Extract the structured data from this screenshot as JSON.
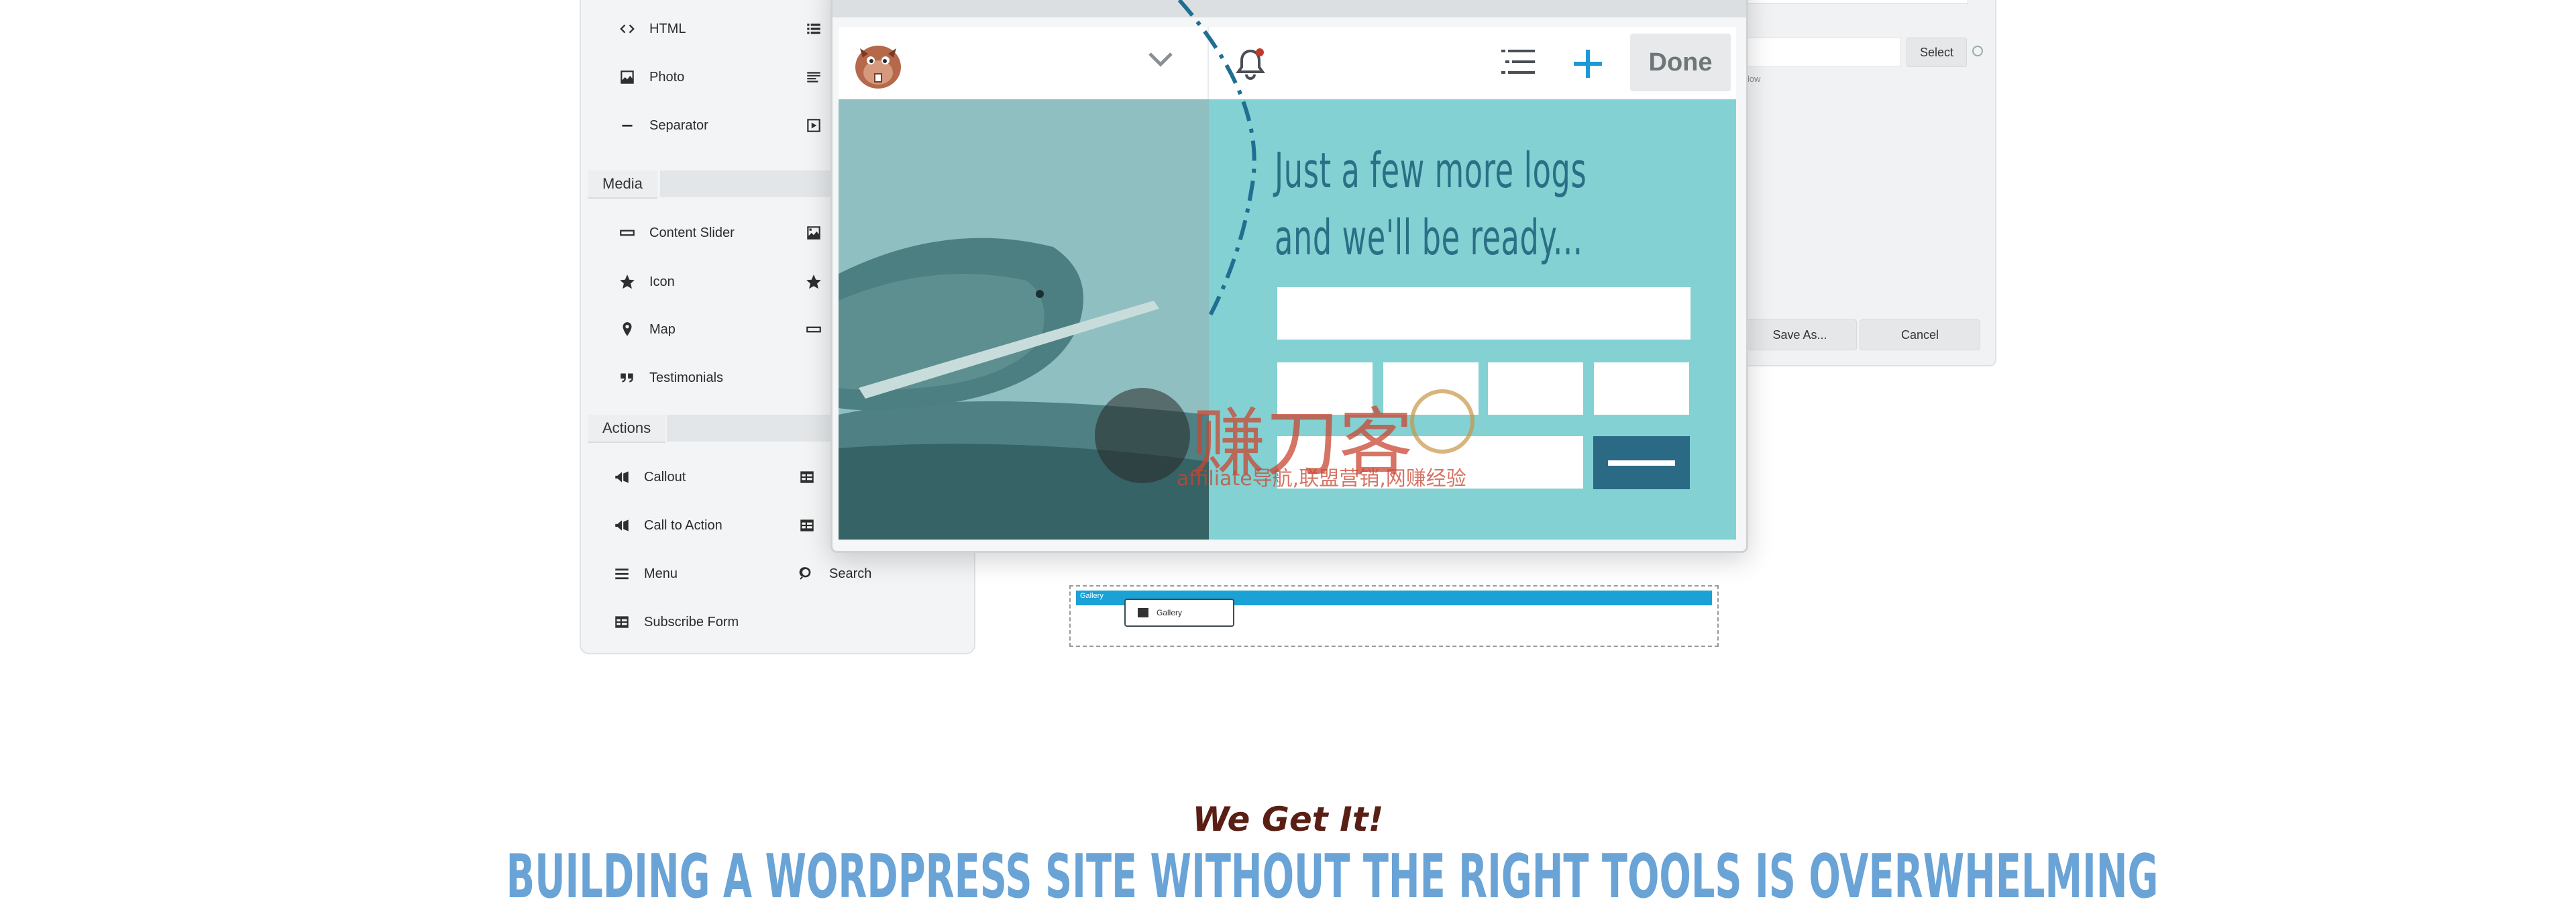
{
  "modules": {
    "basic_left": [
      {
        "label": "HTML",
        "icon": "code-icon"
      },
      {
        "label": "Photo",
        "icon": "photo-icon"
      },
      {
        "label": "Separator",
        "icon": "separator-icon"
      }
    ],
    "basic_right_icons": [
      "list-icon",
      "text-editor-icon",
      "video-icon"
    ],
    "media_title": "Media",
    "media_left": [
      {
        "label": "Content Slider",
        "icon": "slider-icon"
      },
      {
        "label": "Icon",
        "icon": "star-icon"
      },
      {
        "label": "Map",
        "icon": "map-pin-icon"
      },
      {
        "label": "Testimonials",
        "icon": "quote-icon"
      }
    ],
    "media_right_icons": [
      "gallery-icon",
      "star-icon",
      "slider-icon"
    ],
    "actions_title": "Actions",
    "actions_left": [
      {
        "label": "Callout",
        "icon": "megaphone-icon"
      },
      {
        "label": "Call to Action",
        "icon": "megaphone-icon"
      },
      {
        "label": "Menu",
        "icon": "menu-icon"
      },
      {
        "label": "Subscribe Form",
        "icon": "table-icon"
      }
    ],
    "actions_right": [
      {
        "label": "",
        "icon": "table-icon"
      },
      {
        "label": "",
        "icon": "table-icon"
      },
      {
        "label": "Search",
        "icon": "search-icon"
      }
    ]
  },
  "settings": {
    "select_label": "Select",
    "small_text": "llow",
    "save_as_label": "Save As...",
    "cancel_label": "Cancel"
  },
  "beaver_app": {
    "done_label": "Done",
    "headline_line1": "Just a few more logs",
    "headline_line2": "and we'll be ready..."
  },
  "watermark": {
    "main": "赚刀客",
    "sub": "affiliate导航,联盟营销,网赚经验"
  },
  "gallery": {
    "bar_label": "Gallery",
    "chip_label": "Gallery"
  },
  "page": {
    "tagline": "We Get It!",
    "heading": "BUILDING A WORDPRESS SITE WITHOUT THE RIGHT TOOLS IS OVERWHELMING"
  },
  "colors": {
    "teal_panel": "#83d1d2",
    "hero_text": "#2a6f86",
    "submit": "#2b6a85",
    "gallery_bar": "#1aa1d6",
    "tagline": "#5a1f14",
    "heading": "#6aa3d6"
  }
}
